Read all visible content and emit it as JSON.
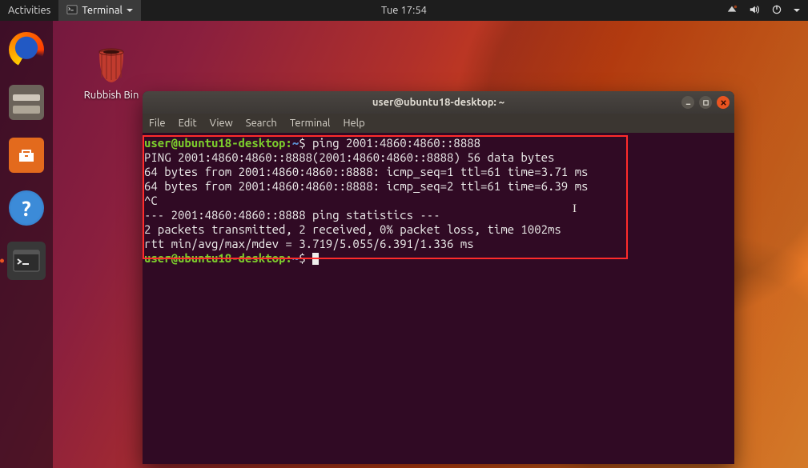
{
  "top_panel": {
    "activities": "Activities",
    "app_indicator": "Terminal",
    "clock": "Tue 17:54"
  },
  "desktop": {
    "trash_label": "Rubbish Bin"
  },
  "dock": {
    "items": [
      {
        "name": "firefox"
      },
      {
        "name": "files"
      },
      {
        "name": "software"
      },
      {
        "name": "help"
      },
      {
        "name": "terminal",
        "active": true
      }
    ]
  },
  "window": {
    "title": "user@ubuntu18-desktop: ~",
    "menubar": [
      "File",
      "Edit",
      "View",
      "Search",
      "Terminal",
      "Help"
    ]
  },
  "terminal": {
    "prompt_user": "user@ubuntu18-desktop",
    "prompt_path": "~",
    "command": "ping 2001:4860:4860::8888",
    "lines": [
      "PING 2001:4860:4860::8888(2001:4860:4860::8888) 56 data bytes",
      "64 bytes from 2001:4860:4860::8888: icmp_seq=1 ttl=61 time=3.71 ms",
      "64 bytes from 2001:4860:4860::8888: icmp_seq=2 ttl=61 time=6.39 ms",
      "^C",
      "--- 2001:4860:4860::8888 ping statistics ---",
      "2 packets transmitted, 2 received, 0% packet loss, time 1002ms",
      "rtt min/avg/max/mdev = 3.719/5.055/6.391/1.336 ms"
    ]
  }
}
